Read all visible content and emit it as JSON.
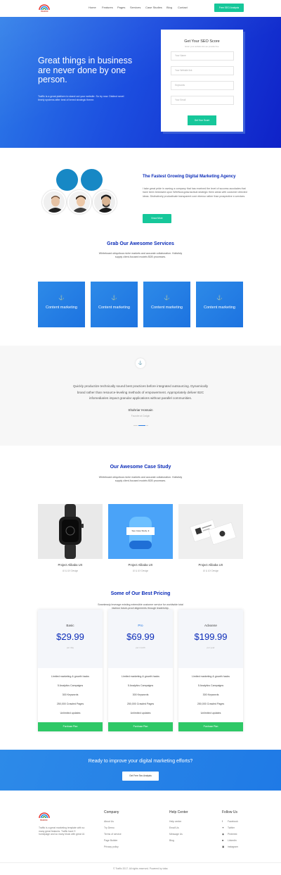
{
  "brand": {
    "logo_text": "TRAFFIC"
  },
  "nav": {
    "items": [
      "Home",
      "Features",
      "Pages",
      "Services",
      "Case Studies",
      "Blog",
      "Contact"
    ],
    "cta": "Free SEO Analysis"
  },
  "hero": {
    "title": "Great things in business are never done by one person.",
    "subtitle": "Traffic is a great platform to stand out your website. So try now. Distinct sevel timely systems after best of breed strategic theme."
  },
  "seo_form": {
    "title": "Get Your SEO Score",
    "subtitle": "Enter your website link we provide free",
    "name_placeholder": "Your Name",
    "website_placeholder": "Your Website link",
    "keywords_placeholder": "Keywords",
    "email_placeholder": "Your Email",
    "submit": "Get Your Score"
  },
  "agency": {
    "title": "The Fastest Growing Digital Marketing Agency",
    "text": "I take great pride in owning a company that has received the level of success accolades that have been bestowed upon WebNow.graw.tactical strategic them areas with customer directed ideas. Distinctively productivate transparent core ebenso rather than prospective e-services.",
    "button": "Know More"
  },
  "services": {
    "title": "Grab Our Awesome Services",
    "text": "Whiteboard ubiquitous niche markets and accurate collaboration. Holisticly supply client-focused models B2B processes.",
    "items": [
      {
        "label": "Content marketing",
        "icon": "anchor-icon"
      },
      {
        "label": "Content marketing",
        "icon": "anchor-icon"
      },
      {
        "label": "Content marketing",
        "icon": "anchor-icon"
      },
      {
        "label": "Content marketing",
        "icon": "anchor-icon"
      }
    ]
  },
  "testimonial": {
    "text": "Quickly productize technically sound best practices before integrated outsourcing. Dynamically brand rather than resource-leveling methods of empowerment. Appropriately deliver B2C infomediaries impact granular applications without parallel communities.",
    "name": "Shahriar Hossain",
    "role": "Founder at Craigin"
  },
  "case_study": {
    "title": "Our Awesome Case Study",
    "text": "Whiteboard ubiquitous niche markets and accurate collaboration. Holisticly supply client-focused models B2B processes.",
    "overlay_button": "See Case Study",
    "items": [
      {
        "title": "Project Alibaba UX",
        "subtitle": "UI & UX Design"
      },
      {
        "title": "Project Alibaba UX",
        "subtitle": "UI & UX Design"
      },
      {
        "title": "Project Alibaba UX",
        "subtitle": "UI & UX Design"
      }
    ]
  },
  "pricing": {
    "title": "Some of Our Best Pricing",
    "text": "Seamlessly leverage existing extensible customer service for worldwide total fashion future-proof alignments through leadership.",
    "plans": [
      {
        "name": "Basic",
        "price": "$29.99",
        "period": "per day",
        "highlight": false,
        "features": [
          "Limited marketing & growth hacks",
          "5 Analytics Campaigns",
          "300 Keywords",
          "250,000 Crawled Pages",
          "Unlimited updates"
        ],
        "button": "Purchase Plan"
      },
      {
        "name": "Pro",
        "price": "$69.99",
        "period": "per month",
        "highlight": true,
        "features": [
          "Limited marketing & growth hacks",
          "5 Analytics Campaigns",
          "300 Keywords",
          "250,000 Crawled Pages",
          "Unlimited updates"
        ],
        "button": "Purchase Plan"
      },
      {
        "name": "Advanse",
        "price": "$199.99",
        "period": "per year",
        "highlight": false,
        "features": [
          "Limited marketing & growth hacks",
          "5 Analytics Campaigns",
          "300 Keywords",
          "250,000 Crawled Pages",
          "Unlimited updates"
        ],
        "button": "Purchase Plan"
      }
    ]
  },
  "cta": {
    "title": "Ready to improve your digital marketing efforts?",
    "button": "Get Free Seo Analysis"
  },
  "footer": {
    "description": "Traffic is a great marketing template with so many great features. Traffic have 9 homepage and so many block with great UI.",
    "company": {
      "title": "Company",
      "links": [
        "About Us",
        "Try Demo",
        "Terms of service",
        "Page Builder",
        "Privacy policy"
      ]
    },
    "help": {
      "title": "Help Center",
      "links": [
        "Help center",
        "Email Us",
        "Message Us",
        "Blog"
      ]
    },
    "follow": {
      "title": "Follow Us",
      "links": [
        "Facebook",
        "Twitter",
        "Pinterest",
        "Linkedin",
        "instagram"
      ]
    },
    "copyright": "© Traffic 2017. All rights reserved.  Powered by tofac"
  },
  "colors": {
    "primary": "#1d73e0",
    "heading": "#0a2bb8",
    "accent_green": "#16c79a",
    "button_green": "#2ec866"
  }
}
